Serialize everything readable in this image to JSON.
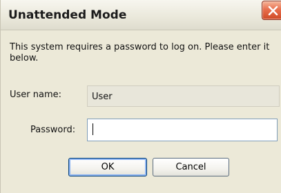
{
  "window": {
    "title": "Unattended Mode",
    "close_icon": "close-icon"
  },
  "colors": {
    "dialog_background": "#ece9d8",
    "close_button": "#e86f4d",
    "field_border": "#7f9db9",
    "default_button_focus": "#8cb4f2"
  },
  "form": {
    "message": "This system requires a password to log on. Please enter it below.",
    "username_label": "User name:",
    "username_value": "User",
    "password_label": "Password:",
    "password_value": ""
  },
  "buttons": {
    "ok_label": "OK",
    "cancel_label": "Cancel"
  }
}
